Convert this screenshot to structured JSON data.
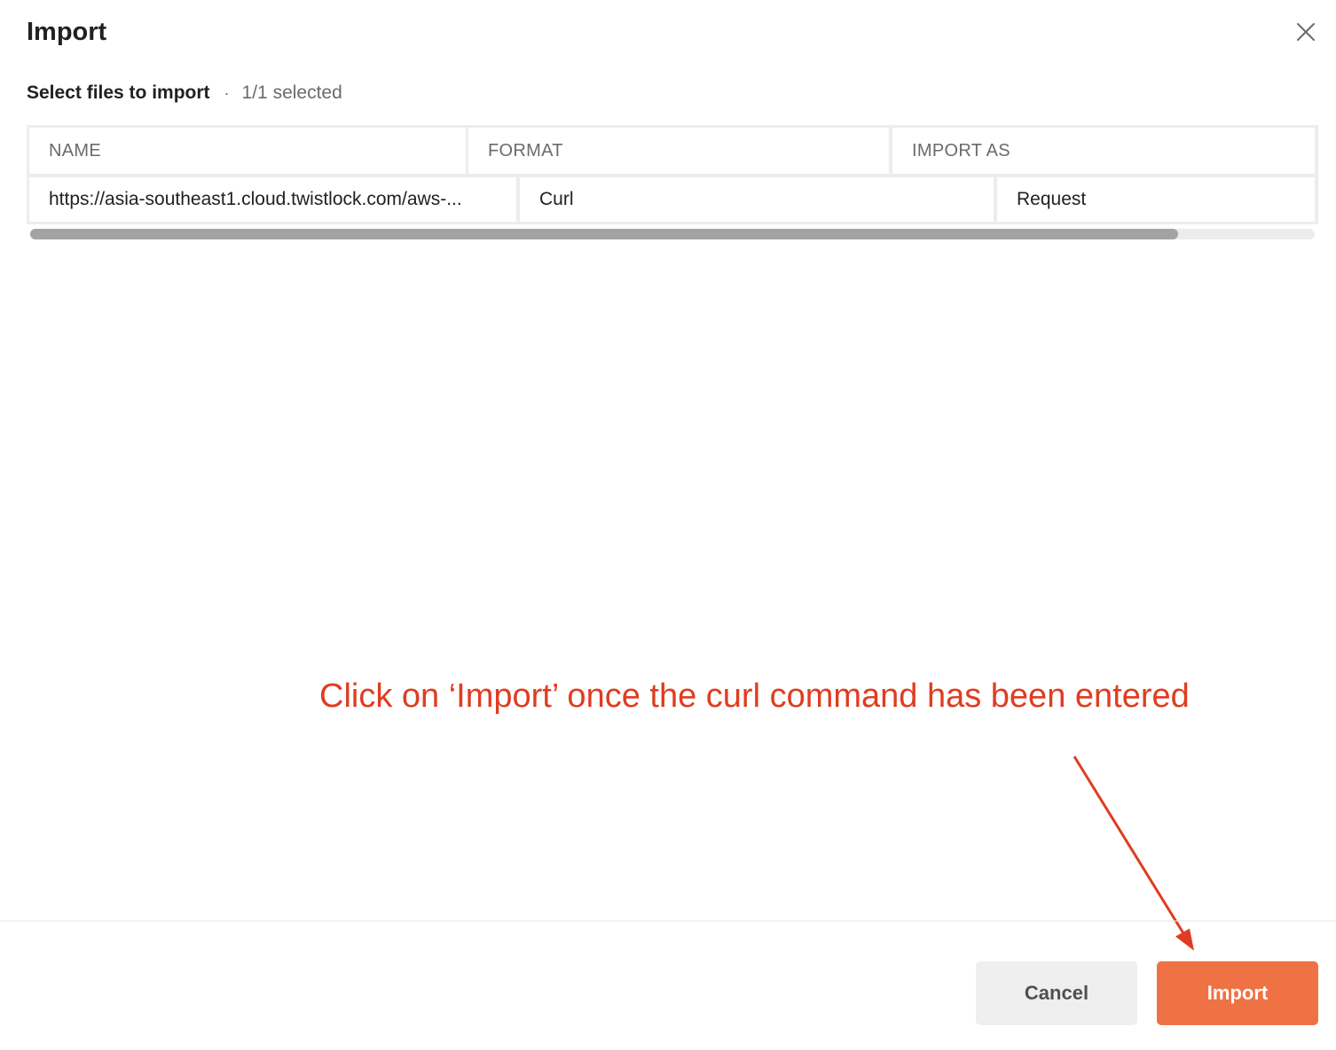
{
  "dialog": {
    "title": "Import",
    "close_icon": "close-icon"
  },
  "subtitle": {
    "label": "Select files to import",
    "separator": "·",
    "count": "1/1 selected"
  },
  "table": {
    "columns": [
      "NAME",
      "FORMAT",
      "IMPORT AS"
    ],
    "rows": [
      {
        "name": "https://asia-southeast1.cloud.twistlock.com/aws-...",
        "format": "Curl",
        "import_as": "Request"
      }
    ]
  },
  "annotation": {
    "text": "Click on ‘Import’ once the curl command has been entered",
    "color": "#e03c21"
  },
  "footer": {
    "cancel_label": "Cancel",
    "import_label": "Import"
  },
  "colors": {
    "accent": "#ef7245",
    "annotation": "#e03c21"
  }
}
